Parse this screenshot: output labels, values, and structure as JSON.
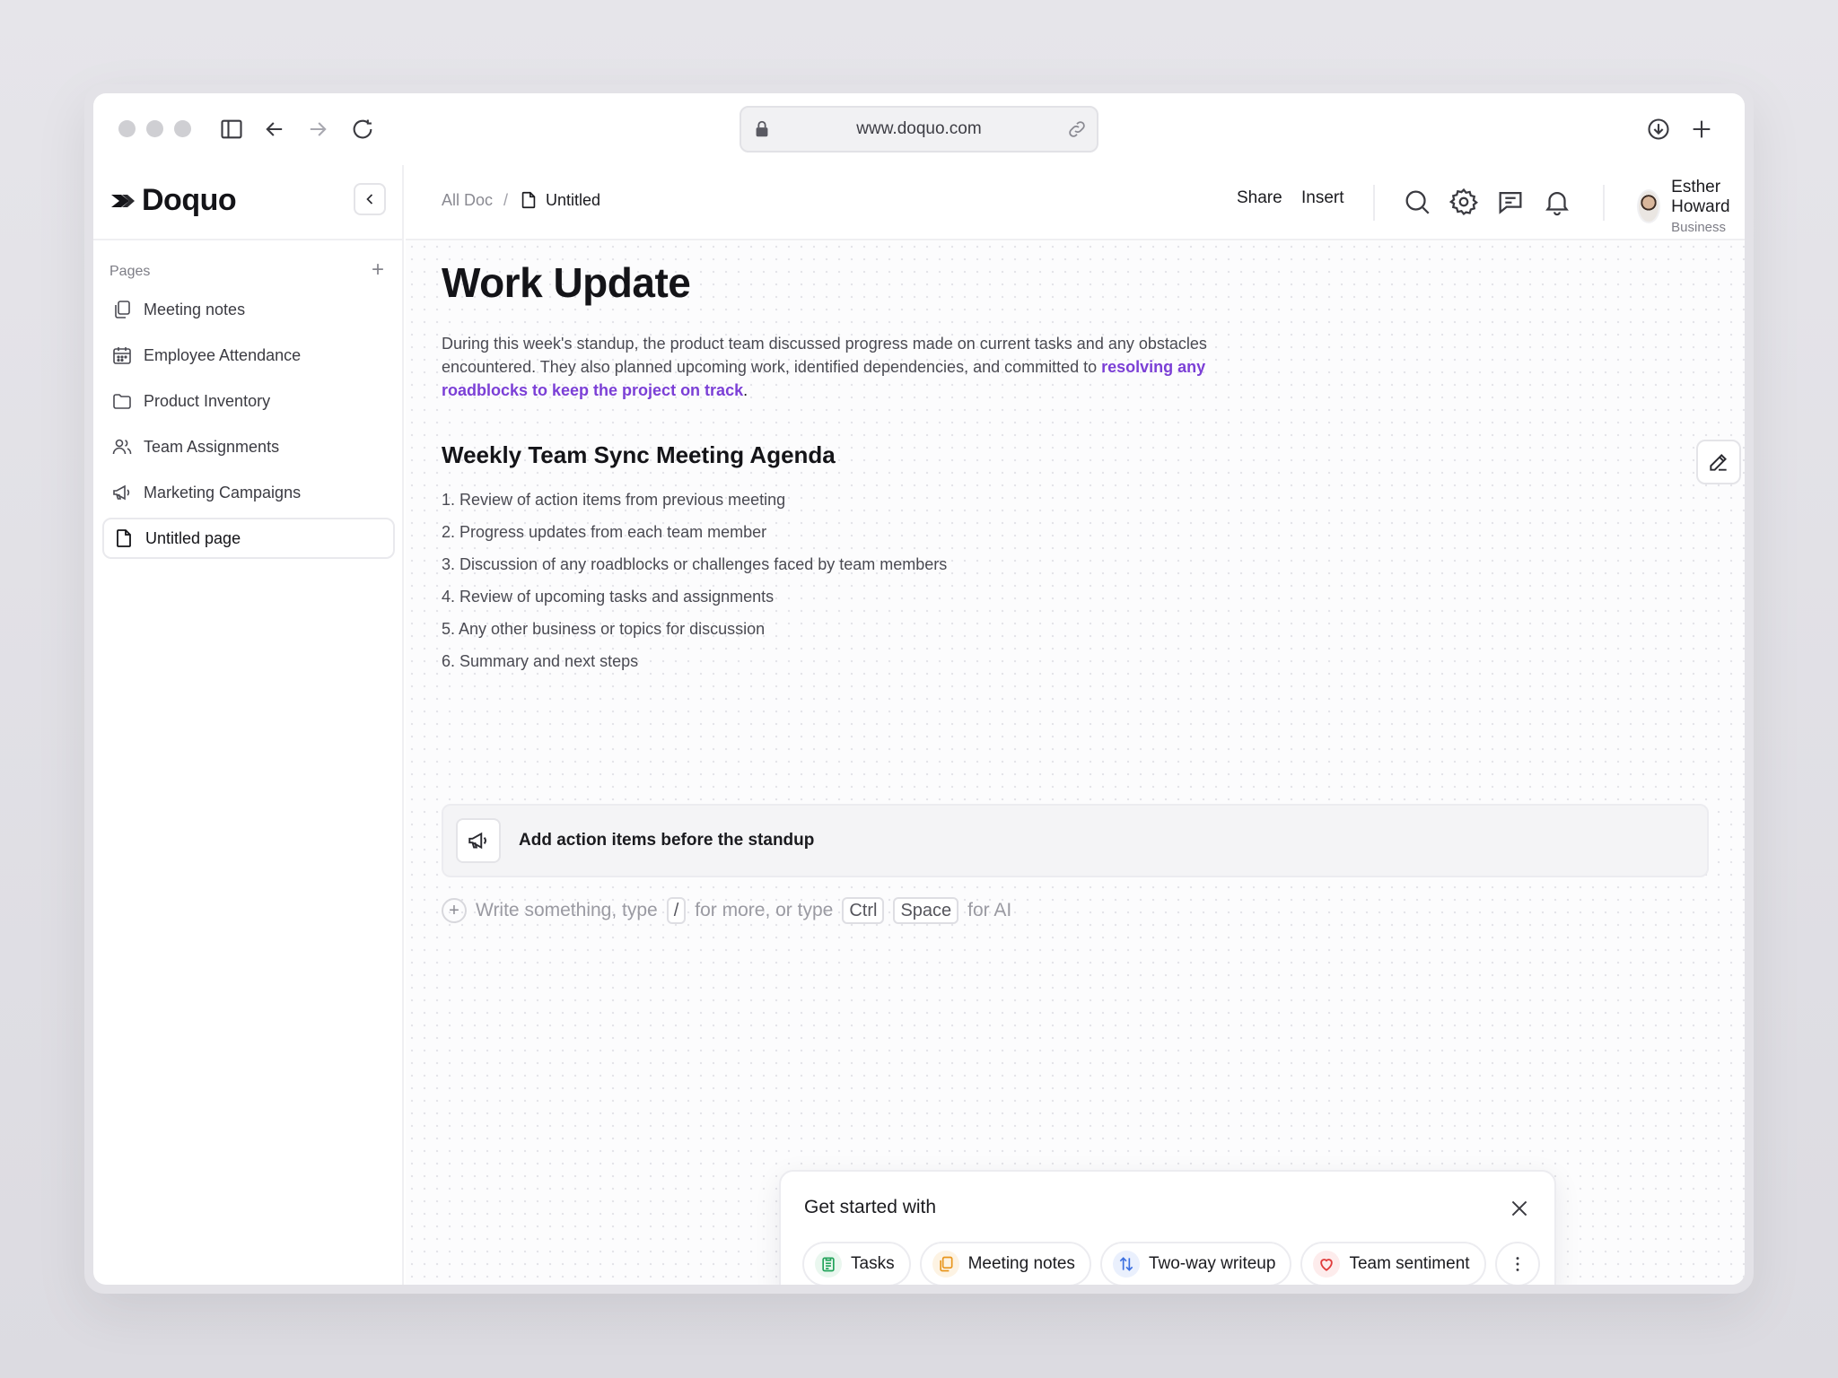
{
  "browser": {
    "url": "www.doquo.com"
  },
  "brand": {
    "name": "Doquo"
  },
  "sidebar": {
    "section_label": "Pages",
    "items": [
      {
        "label": "Meeting notes",
        "icon": "copy-icon"
      },
      {
        "label": "Employee Attendance",
        "icon": "calendar-icon"
      },
      {
        "label": "Product Inventory",
        "icon": "folder-icon"
      },
      {
        "label": "Team Assignments",
        "icon": "users-icon"
      },
      {
        "label": "Marketing Campaigns",
        "icon": "megaphone-icon"
      },
      {
        "label": "Untitled page",
        "icon": "file-icon",
        "active": true
      }
    ]
  },
  "topbar": {
    "breadcrumb_root": "All Doc",
    "breadcrumb_sep": "/",
    "breadcrumb_current": "Untitled",
    "share_label": "Share",
    "insert_label": "Insert",
    "user_name": "Esther Howard",
    "user_plan": "Business"
  },
  "document": {
    "title": "Work Update",
    "paragraph_text": "During this week's standup, the product team discussed progress made on current tasks and any obstacles encountered. They also planned upcoming work, identified dependencies, and committed to ",
    "paragraph_highlight": "resolving any roadblocks to keep the project on track",
    "paragraph_end": ".",
    "agenda_title": "Weekly Team Sync Meeting Agenda",
    "agenda": [
      "1. Review of action items from previous meeting",
      "2. Progress updates from each team member",
      "3. Discussion of any roadblocks or challenges faced by team members",
      "4. Review of upcoming tasks and assignments",
      "5. Any other business or topics for discussion",
      "6. Summary and next steps"
    ],
    "callout_text": "Add action items before the standup",
    "compose": {
      "part1": "Write something, type",
      "key_slash": "/",
      "part2": "for more, or type",
      "key_ctrl": "Ctrl",
      "key_space": "Space",
      "part3": "for AI"
    }
  },
  "starter": {
    "title": "Get started with",
    "chips": [
      {
        "label": "Tasks",
        "icon": "clipboard-icon",
        "color": "#22a35a"
      },
      {
        "label": "Meeting notes",
        "icon": "copy-icon",
        "color": "#e8951c"
      },
      {
        "label": "Two-way writeup",
        "icon": "arrows-updown-icon",
        "color": "#3b6fe0"
      },
      {
        "label": "Team sentiment",
        "icon": "heart-icon",
        "color": "#e03b3b"
      }
    ]
  },
  "colors": {
    "accent": "#7b3fd6"
  }
}
